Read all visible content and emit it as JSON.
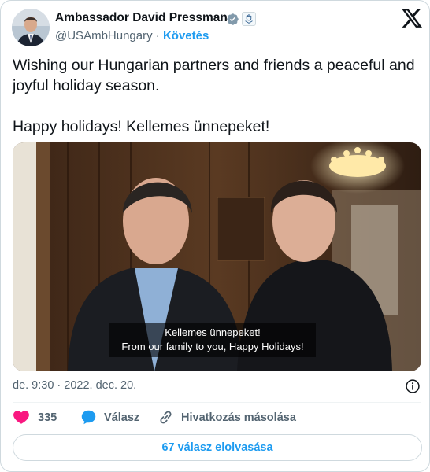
{
  "author": {
    "name": "Ambassador David Pressman",
    "handle": "@USAmbHungary",
    "separator": "·",
    "follow_label": "Követés"
  },
  "tweet": {
    "line1": "Wishing our Hungarian partners and friends a peaceful and joyful holiday season.",
    "line2": "Happy holidays! Kellemes ünnepeket!"
  },
  "video": {
    "caption_line1": "Kellemes ünnepeket!",
    "caption_line2": "From our family to you, Happy Holidays!"
  },
  "meta": {
    "timestamp": "de. 9:30 · 2022. dec. 20."
  },
  "actions": {
    "like_count": "335",
    "reply_label": "Válasz",
    "copy_link_label": "Hivatkozás másolása"
  },
  "read_replies_label": "67 válasz elolvasása",
  "colors": {
    "accent": "#1d9bf0",
    "like": "#f91880",
    "text": "#0f1419",
    "muted": "#536471"
  },
  "icons": [
    "verified-badge-icon",
    "government-affiliation-icon",
    "x-logo-icon",
    "info-icon",
    "heart-icon",
    "reply-bubble-icon",
    "link-icon"
  ]
}
